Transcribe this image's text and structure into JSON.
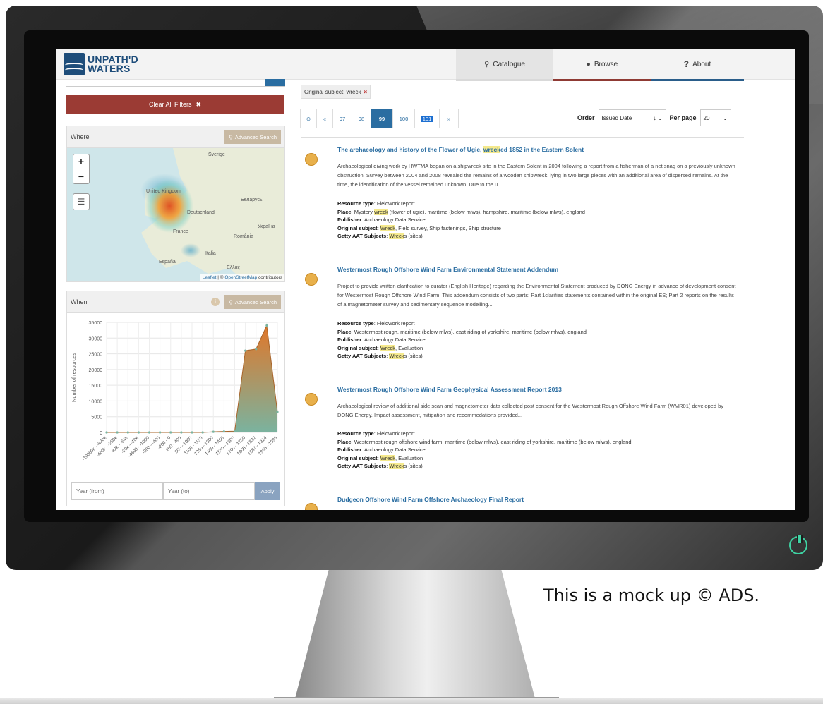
{
  "footer_note": "This is a mock up © ADS.",
  "brand": {
    "line1": "UNPATH'D",
    "line2": "WATERS",
    "color": "#1e4d7a"
  },
  "nav": {
    "catalogue": {
      "label": "Catalogue",
      "icon": "search-icon"
    },
    "browse": {
      "label": "Browse",
      "icon": "globe-icon"
    },
    "about": {
      "label": "About",
      "icon": "question-icon"
    }
  },
  "sidebar": {
    "clear_filters": "Clear All Filters",
    "where": {
      "title": "Where",
      "advanced": "Advanced Search"
    },
    "map": {
      "zoom_in": "+",
      "zoom_out": "−",
      "labels": [
        "Sverige",
        "United Kingdom",
        "Беларусь",
        "Deutschland",
        "Україна",
        "France",
        "România",
        "Italia",
        "España",
        "Ελλάς"
      ],
      "attribution_leaflet": "Leaflet",
      "attribution_sep": " | © ",
      "attribution_osm": "OpenStreetMap",
      "attribution_rest": " contributors"
    },
    "when": {
      "title": "When",
      "advanced": "Advanced Search"
    },
    "year_from": "Year (from)",
    "year_to": "Year (to)",
    "apply": "Apply"
  },
  "chart_data": {
    "type": "area",
    "ylabel": "Number of resources",
    "ylim": [
      0,
      35000
    ],
    "yticks": [
      0,
      5000,
      10000,
      15000,
      20000,
      25000,
      30000,
      35000
    ],
    "x": [
      "-10000k - -820k",
      "-460k - -280k",
      "-82k - -64k",
      "-28k - -10k",
      "-4600 - -1000",
      "-800 - -400",
      "-200 - 0",
      "200 - 400",
      "800 - 1000",
      "1100 - 1150",
      "1250 - 1300",
      "1400 - 1450",
      "1550 - 1600",
      "1700 - 1750",
      "1805 - 1832",
      "1887 - 1914",
      "1968 - 1996"
    ],
    "values": [
      0,
      0,
      0,
      0,
      0,
      0,
      0,
      0,
      0,
      0,
      200,
      300,
      400,
      26000,
      26500,
      34000,
      6500
    ],
    "colors": {
      "top": "#e0772a",
      "bottom": "#7ab39f"
    }
  },
  "filter": {
    "label": "Original subject: wreck",
    "remove": "×"
  },
  "pagination": {
    "first": "⊙",
    "prev": "«",
    "pages": [
      "97",
      "98",
      "99",
      "100",
      "101"
    ],
    "active": "99",
    "next": "»"
  },
  "order": {
    "label": "Order",
    "value": "Issued Date",
    "per_page_label": "Per page",
    "per_page": "20"
  },
  "results": [
    {
      "title_pre": "The archaeology and history of the Flower of Ugie, ",
      "title_hl": "wreck",
      "title_post": "ed 1852 in the Eastern Solent",
      "desc": "Archaeological diving work by HWTMA began on a shipwreck site in the Eastern Solent in 2004 following a report from a fisherman of a net snag on a previously unknown obstruction. Survey between 2004 and 2008 revealed the remains of a wooden shipwreck, lying in two large pieces with an additional area of dispersed remains. At the time, the identification of the vessel remained unknown. Due to the u..",
      "resource_type": "Fieldwork report",
      "place_pre": "Mystery ",
      "place_hl": "wreck",
      "place_post": " (flower of ugie), maritime (below mlws), hampshire, maritime (below mlws), england",
      "publisher": "Archaeology Data Service",
      "subject_hl": "Wreck",
      "subject_post": ", Field survey, Ship fastenings, Ship structure",
      "getty_hl": "Wreck",
      "getty_post": "s (sites)"
    },
    {
      "title": "Westermost Rough Offshore Wind Farm Environmental Statement Addendum",
      "desc": "Project to provide written clarification to curator (English Heritage) regarding the Environmental Statement produced by DONG Energy in advance of development consent for Westermost Rough Offshore Wind Farm. This addendum consists of two parts: Part 1clarifies statements contained within the original ES; Part 2 reports on the results of a magnetometer survey and sedimentary sequence modelling...",
      "resource_type": "Fieldwork report",
      "place": "Westermost rough, maritime (below mlws), east riding of yorkshire, maritime (below mlws), england",
      "publisher": "Archaeology Data Service",
      "subject_hl": "Wreck",
      "subject_post": ", Evaluation",
      "getty_hl": "Wreck",
      "getty_post": "s (sites)"
    },
    {
      "title": "Westermost Rough Offshore Wind Farm Geophysical Assessment Report 2013",
      "desc": "Archaeological review of additional side scan and magnetometer data collected post consent for the Westermost Rough Offshore Wind Farm (WMR01) developed by DONG Energy. Impact assessment, mitigation and recommedations provided...",
      "resource_type": "Fieldwork report",
      "place": "Westermost rough offshore wind farm, maritime (below mlws), east riding of yorkshire, maritime (below mlws), england",
      "publisher": "Archaeology Data Service",
      "subject_hl": "Wreck",
      "subject_post": ", Evaluation",
      "getty_hl": "Wreck",
      "getty_post": "s (sites)"
    },
    {
      "title": "Dudgeon Offshore Wind Farm Offshore Archaeology Final Report"
    }
  ],
  "meta_labels": {
    "resource_type": "Resource type",
    "place": "Place",
    "publisher": "Publisher",
    "subject": "Original subject",
    "getty": "Getty AAT Subjects"
  }
}
